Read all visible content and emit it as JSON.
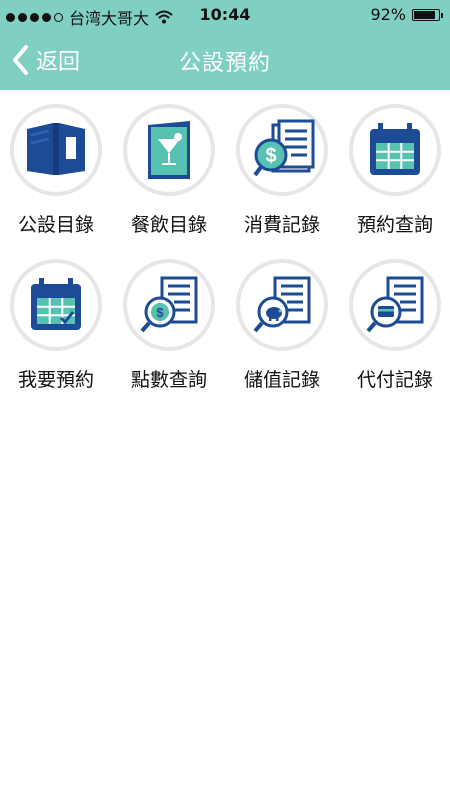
{
  "status": {
    "carrier": "台湾大哥大",
    "time": "10:44",
    "battery": "92%",
    "battery_level": 0.92
  },
  "nav": {
    "back_label": "返回",
    "title": "公設預約"
  },
  "items": [
    {
      "label": "公設目錄",
      "icon": "book-icon"
    },
    {
      "label": "餐飲目錄",
      "icon": "drink-menu-icon"
    },
    {
      "label": "消費記錄",
      "icon": "dollar-receipt-icon"
    },
    {
      "label": "預約查詢",
      "icon": "calendar-icon"
    },
    {
      "label": "我要預約",
      "icon": "calendar-check-icon"
    },
    {
      "label": "點數查詢",
      "icon": "coin-search-icon"
    },
    {
      "label": "儲值記錄",
      "icon": "piggy-bank-icon"
    },
    {
      "label": "代付記錄",
      "icon": "card-icon"
    }
  ],
  "colors": {
    "primary": "#7fd0c3",
    "icon_blue": "#1d4b96",
    "icon_teal": "#57c1b2"
  }
}
